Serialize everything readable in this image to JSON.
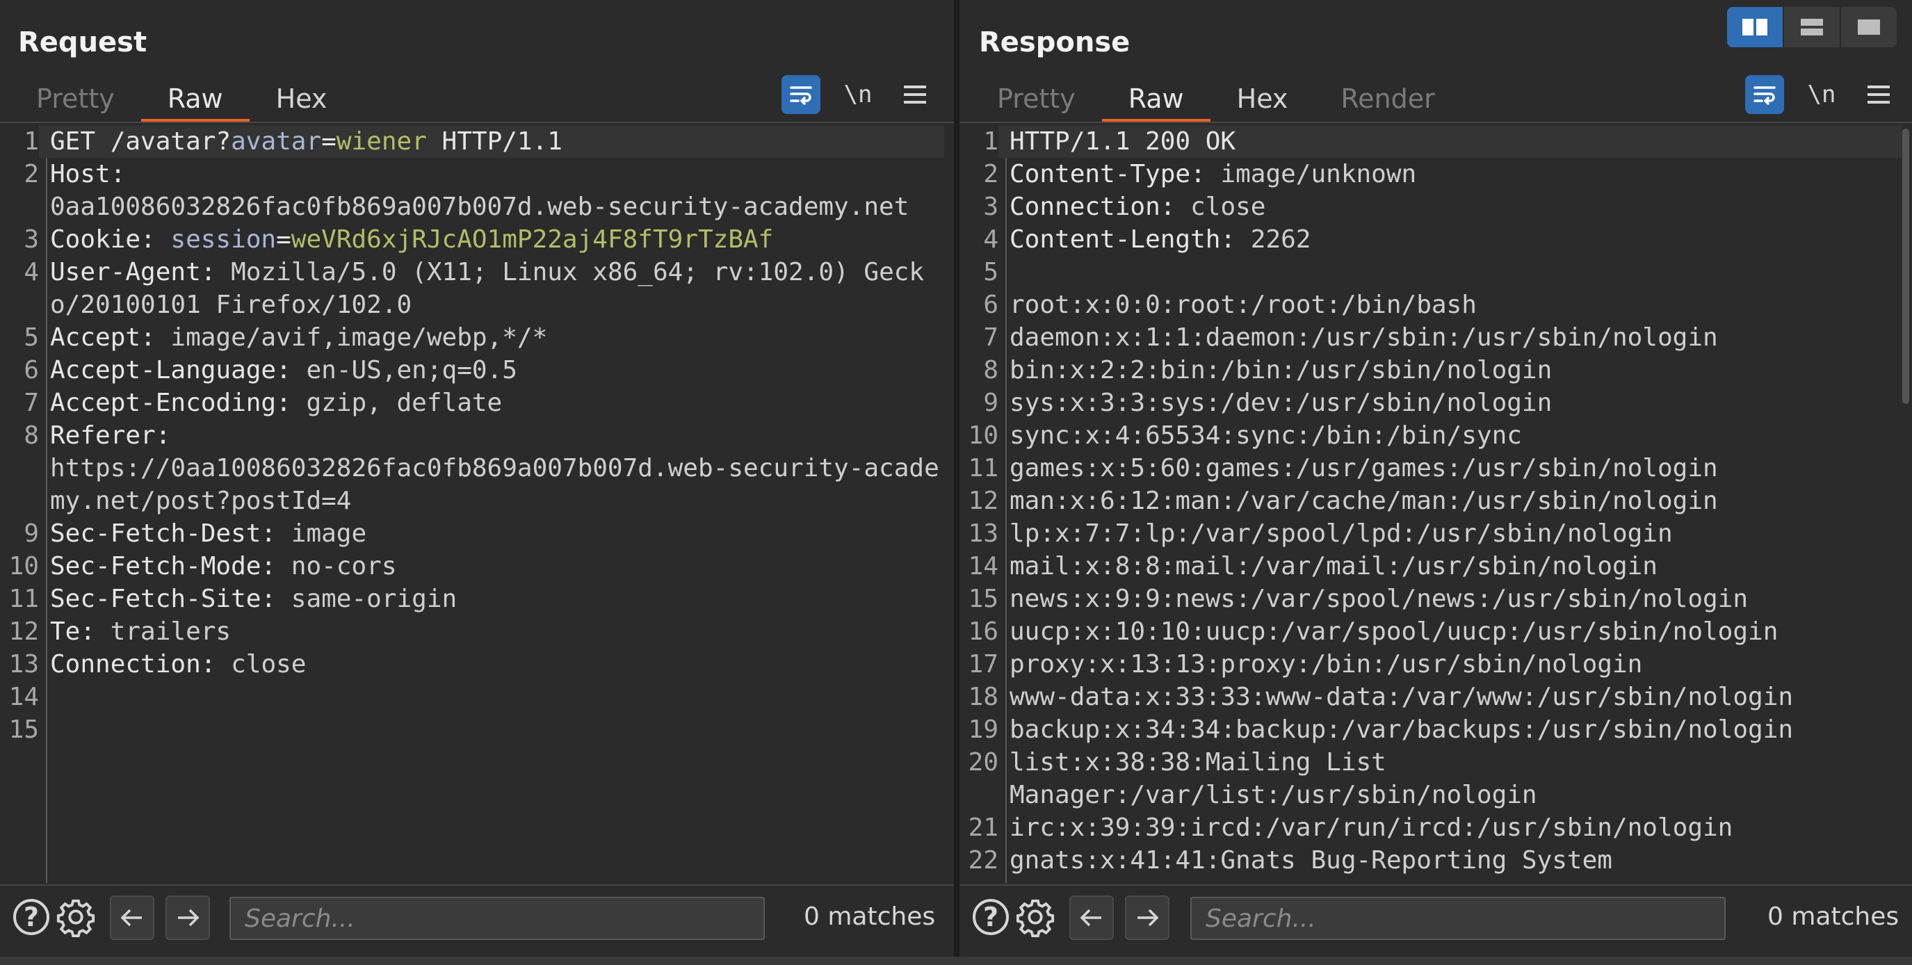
{
  "layout_buttons": [
    "side-by-side",
    "stacked",
    "single"
  ],
  "request": {
    "title": "Request",
    "tabs": [
      "Pretty",
      "Raw",
      "Hex"
    ],
    "active_tab": "Raw",
    "newline_label": "\\n",
    "lines": [
      {
        "n": "1",
        "parts": [
          [
            "GET /avatar?",
            "kw"
          ],
          [
            "avatar",
            "param"
          ],
          [
            "=",
            "kw"
          ],
          [
            "wiener",
            "green"
          ],
          [
            " HTTP/1.1",
            "kw"
          ]
        ]
      },
      {
        "n": "2",
        "parts": [
          [
            "Host: ",
            "name"
          ],
          [
            "\n0aa10086032826fac0fb869a007b007d.web-security-academy.net",
            "val"
          ]
        ]
      },
      {
        "n": "3",
        "parts": [
          [
            "Cookie: ",
            "name"
          ],
          [
            "session",
            "session"
          ],
          [
            "=",
            "kw"
          ],
          [
            "weVRd6xjRJcAO1mP22aj4F8fT9rTzBAf",
            "green"
          ]
        ]
      },
      {
        "n": "4",
        "parts": [
          [
            "User-Agent: ",
            "name"
          ],
          [
            "Mozilla/5.0 (X11; Linux x86_64; rv:102.0) Gecko/20100101 Firefox/102.0",
            "val"
          ]
        ]
      },
      {
        "n": "5",
        "parts": [
          [
            "Accept: ",
            "name"
          ],
          [
            "image/avif,image/webp,*/*",
            "val"
          ]
        ]
      },
      {
        "n": "6",
        "parts": [
          [
            "Accept-Language: ",
            "name"
          ],
          [
            "en-US,en;q=0.5",
            "val"
          ]
        ]
      },
      {
        "n": "7",
        "parts": [
          [
            "Accept-Encoding: ",
            "name"
          ],
          [
            "gzip, deflate",
            "val"
          ]
        ]
      },
      {
        "n": "8",
        "parts": [
          [
            "Referer: ",
            "name"
          ],
          [
            "\nhttps://0aa10086032826fac0fb869a007b007d.web-security-academy.net/post?postId=4",
            "val"
          ]
        ]
      },
      {
        "n": "9",
        "parts": [
          [
            "Sec-Fetch-Dest: ",
            "name"
          ],
          [
            "image",
            "val"
          ]
        ]
      },
      {
        "n": "10",
        "parts": [
          [
            "Sec-Fetch-Mode: ",
            "name"
          ],
          [
            "no-cors",
            "val"
          ]
        ]
      },
      {
        "n": "11",
        "parts": [
          [
            "Sec-Fetch-Site: ",
            "name"
          ],
          [
            "same-origin",
            "val"
          ]
        ]
      },
      {
        "n": "12",
        "parts": [
          [
            "Te: ",
            "name"
          ],
          [
            "trailers",
            "val"
          ]
        ]
      },
      {
        "n": "13",
        "parts": [
          [
            "Connection: ",
            "name"
          ],
          [
            "close",
            "val"
          ]
        ]
      },
      {
        "n": "14",
        "parts": []
      },
      {
        "n": "15",
        "parts": []
      }
    ],
    "search_placeholder": "Search...",
    "matches": "0 matches"
  },
  "response": {
    "title": "Response",
    "tabs": [
      "Pretty",
      "Raw",
      "Hex",
      "Render"
    ],
    "active_tab": "Raw",
    "newline_label": "\\n",
    "lines": [
      {
        "n": "1",
        "parts": [
          [
            "HTTP/1.1 200 OK",
            "kw"
          ]
        ]
      },
      {
        "n": "2",
        "parts": [
          [
            "Content-Type: ",
            "name"
          ],
          [
            "image/unknown",
            "val"
          ]
        ]
      },
      {
        "n": "3",
        "parts": [
          [
            "Connection: ",
            "name"
          ],
          [
            "close",
            "val"
          ]
        ]
      },
      {
        "n": "4",
        "parts": [
          [
            "Content-Length: ",
            "name"
          ],
          [
            "2262",
            "val"
          ]
        ]
      },
      {
        "n": "5",
        "parts": []
      },
      {
        "n": "6",
        "parts": [
          [
            "root:x:0:0:root:/root:/bin/bash",
            "val"
          ]
        ]
      },
      {
        "n": "7",
        "parts": [
          [
            "daemon:x:1:1:daemon:/usr/sbin:/usr/sbin/nologin",
            "val"
          ]
        ]
      },
      {
        "n": "8",
        "parts": [
          [
            "bin:x:2:2:bin:/bin:/usr/sbin/nologin",
            "val"
          ]
        ]
      },
      {
        "n": "9",
        "parts": [
          [
            "sys:x:3:3:sys:/dev:/usr/sbin/nologin",
            "val"
          ]
        ]
      },
      {
        "n": "10",
        "parts": [
          [
            "sync:x:4:65534:sync:/bin:/bin/sync",
            "val"
          ]
        ]
      },
      {
        "n": "11",
        "parts": [
          [
            "games:x:5:60:games:/usr/games:/usr/sbin/nologin",
            "val"
          ]
        ]
      },
      {
        "n": "12",
        "parts": [
          [
            "man:x:6:12:man:/var/cache/man:/usr/sbin/nologin",
            "val"
          ]
        ]
      },
      {
        "n": "13",
        "parts": [
          [
            "lp:x:7:7:lp:/var/spool/lpd:/usr/sbin/nologin",
            "val"
          ]
        ]
      },
      {
        "n": "14",
        "parts": [
          [
            "mail:x:8:8:mail:/var/mail:/usr/sbin/nologin",
            "val"
          ]
        ]
      },
      {
        "n": "15",
        "parts": [
          [
            "news:x:9:9:news:/var/spool/news:/usr/sbin/nologin",
            "val"
          ]
        ]
      },
      {
        "n": "16",
        "parts": [
          [
            "uucp:x:10:10:uucp:/var/spool/uucp:/usr/sbin/nologin",
            "val"
          ]
        ]
      },
      {
        "n": "17",
        "parts": [
          [
            "proxy:x:13:13:proxy:/bin:/usr/sbin/nologin",
            "val"
          ]
        ]
      },
      {
        "n": "18",
        "parts": [
          [
            "www-data:x:33:33:www-data:/var/www:/usr/sbin/nologin",
            "val"
          ]
        ]
      },
      {
        "n": "19",
        "parts": [
          [
            "backup:x:34:34:backup:/var/backups:/usr/sbin/nologin",
            "val"
          ]
        ]
      },
      {
        "n": "20",
        "parts": [
          [
            "list:x:38:38:Mailing List\nManager:/var/list:/usr/sbin/nologin",
            "val"
          ]
        ]
      },
      {
        "n": "21",
        "parts": [
          [
            "irc:x:39:39:ircd:/var/run/ircd:/usr/sbin/nologin",
            "val"
          ]
        ]
      },
      {
        "n": "22",
        "parts": [
          [
            "gnats:x:41:41:Gnats Bug-Reporting System",
            "val"
          ]
        ]
      }
    ],
    "search_placeholder": "Search...",
    "matches": "0 matches"
  }
}
